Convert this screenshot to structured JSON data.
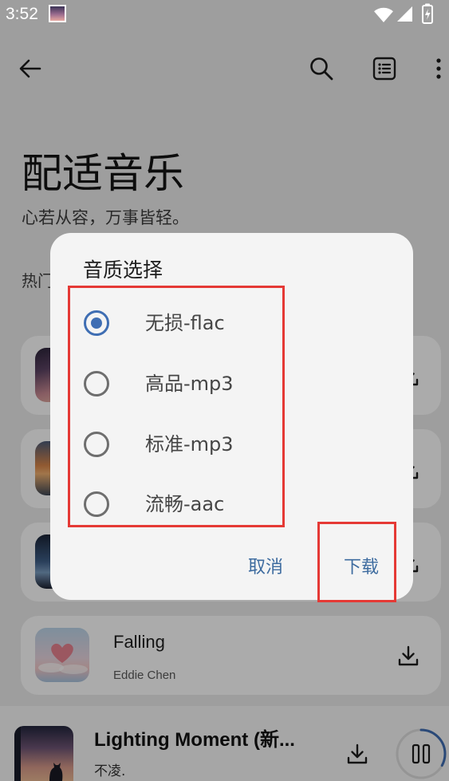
{
  "status_bar": {
    "time": "3:52",
    "icons": [
      "notification-image-icon",
      "wifi-icon",
      "signal-icon",
      "battery-charging-icon"
    ]
  },
  "app_bar": {
    "icons": [
      "back-arrow-icon",
      "search-icon",
      "list-icon",
      "more-vert-icon"
    ]
  },
  "header": {
    "title": "配适音乐",
    "subtitle": "心若从容，万事皆轻。",
    "section_label": "热门"
  },
  "songs": [
    {
      "icon": "download-icon"
    },
    {
      "icon": "download-icon"
    },
    {
      "icon": "download-icon"
    },
    {
      "title": "Falling",
      "artist": "Eddie Chen",
      "icon": "download-icon"
    }
  ],
  "player": {
    "title": "Lighting Moment (新...",
    "artist": "不凌.",
    "progress": 0.33,
    "icons": [
      "download-icon",
      "pause-icon"
    ]
  },
  "dialog": {
    "title": "音质选择",
    "options": [
      {
        "label": "无损-flac",
        "selected": true
      },
      {
        "label": "高品-mp3",
        "selected": false
      },
      {
        "label": "标准-mp3",
        "selected": false
      },
      {
        "label": "流畅-aac",
        "selected": false
      }
    ],
    "cancel_label": "取消",
    "confirm_label": "下载"
  },
  "colors": {
    "accent": "#3d6b9f",
    "radio_selected": "#3f6eb3",
    "annotation": "#e53935"
  }
}
